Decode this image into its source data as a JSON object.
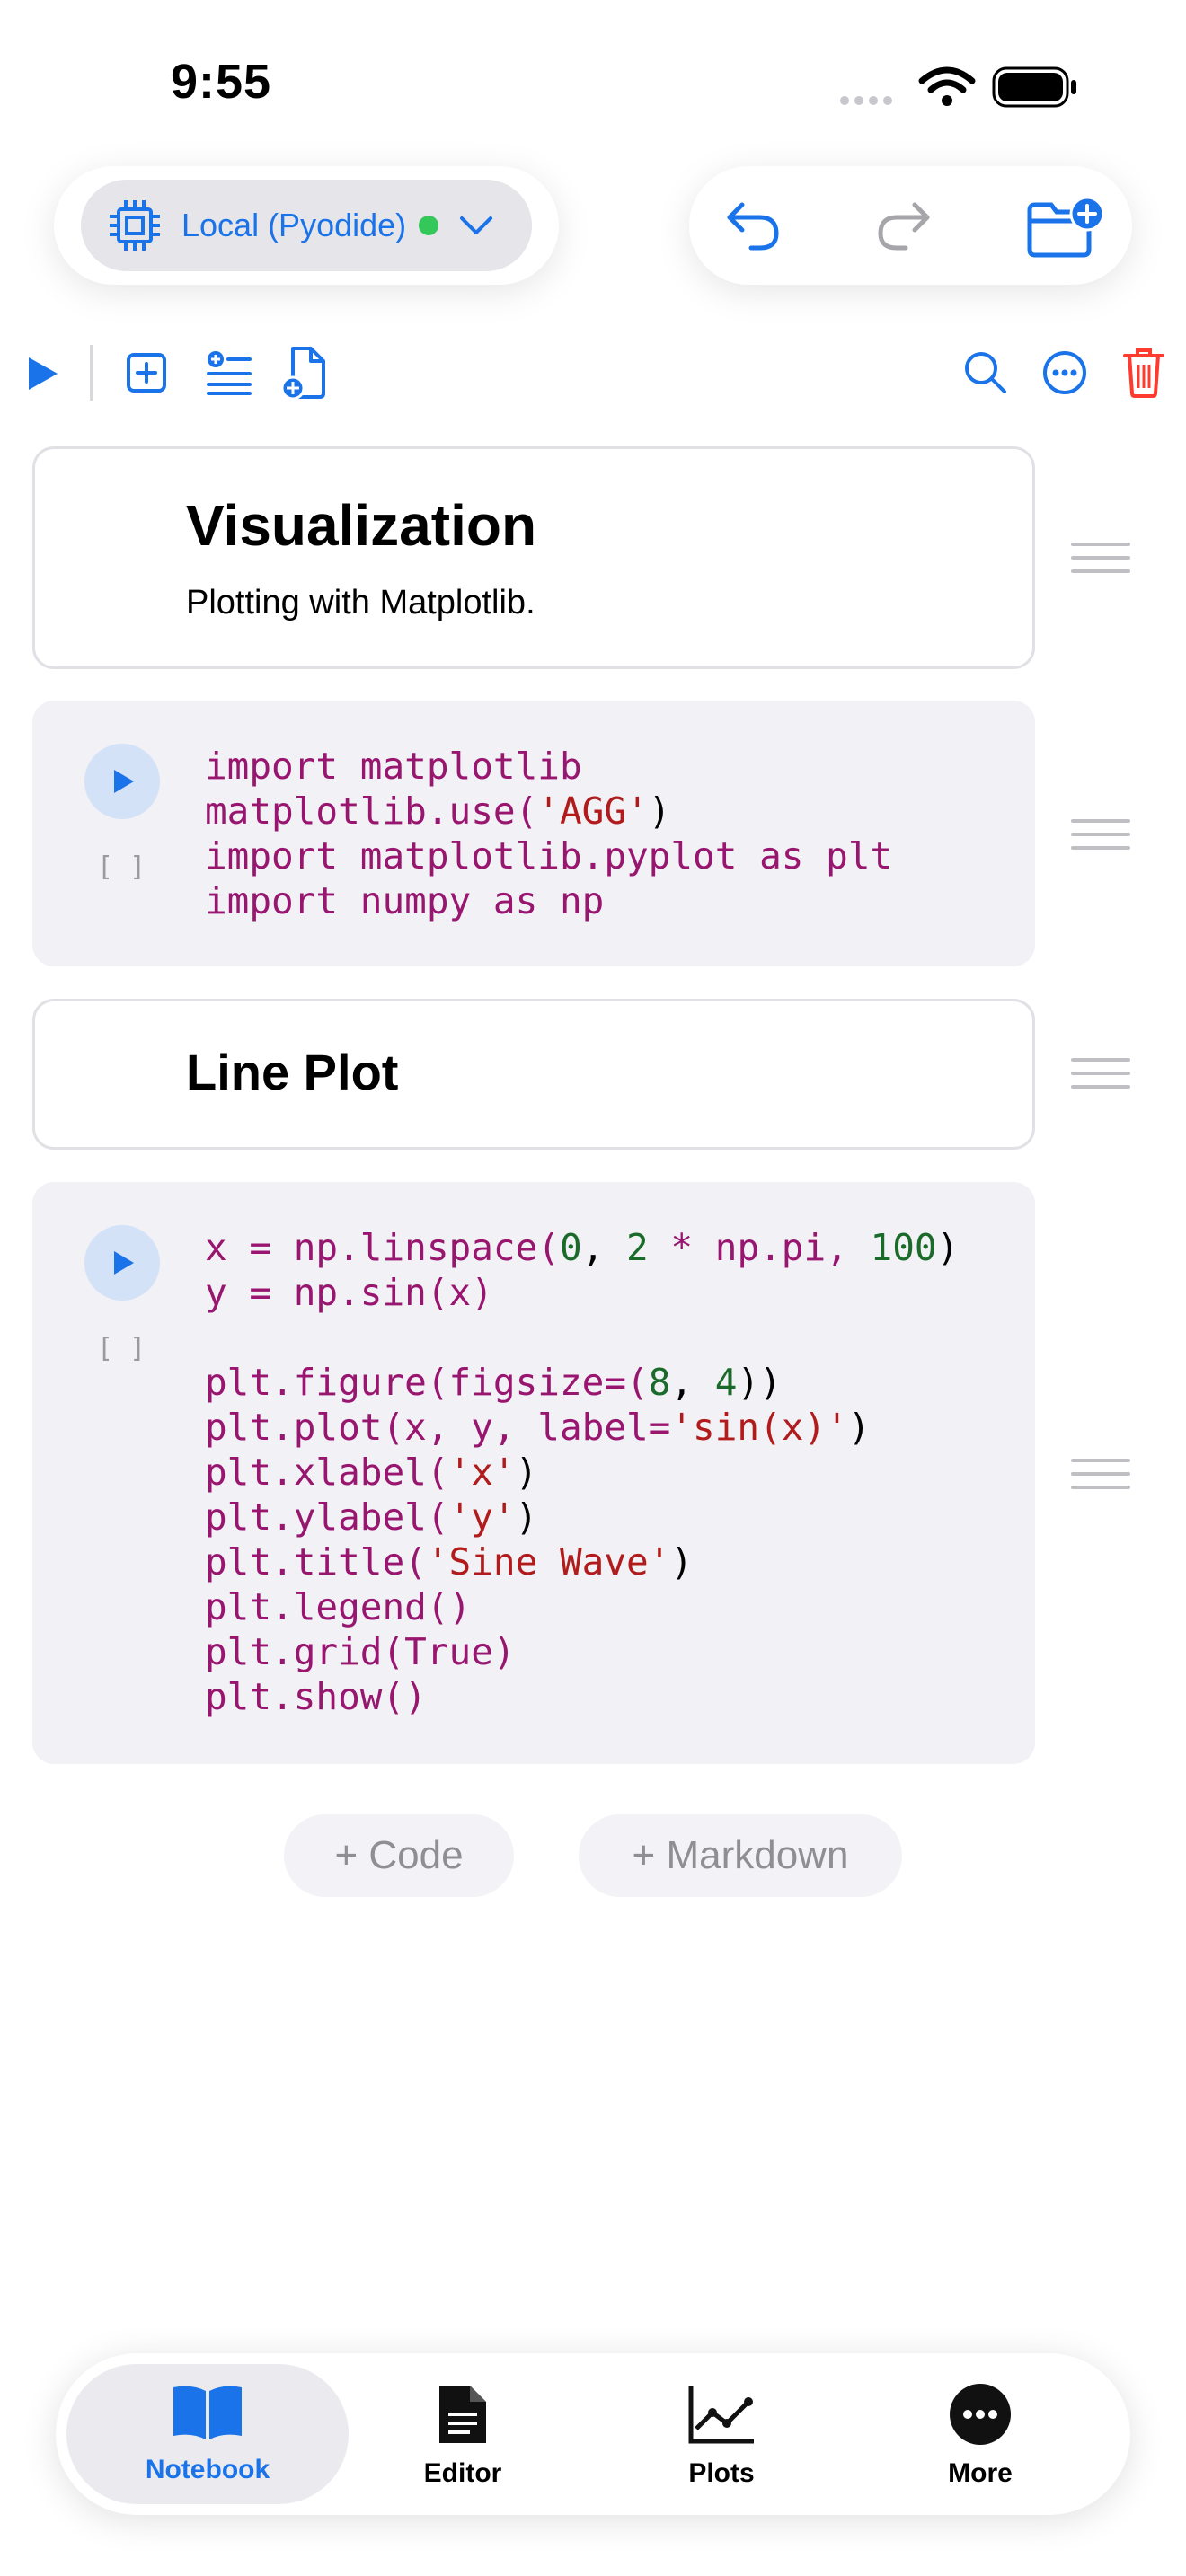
{
  "status_bar": {
    "time": "9:55"
  },
  "kernel": {
    "label": "Local (Pyodide)",
    "status_color": "#34c759"
  },
  "cells": [
    {
      "type": "markdown",
      "heading": "Visualization",
      "text": "Plotting with Matplotlib."
    },
    {
      "type": "code",
      "exec_count": "[ ]",
      "lines": [
        "import matplotlib",
        "matplotlib.use('AGG')",
        "import matplotlib.pyplot as plt",
        "import numpy as np"
      ]
    },
    {
      "type": "markdown",
      "heading": "Line Plot"
    },
    {
      "type": "code",
      "exec_count": "[ ]",
      "lines": [
        "x = np.linspace(0, 2 * np.pi, 100)",
        "y = np.sin(x)",
        "",
        "plt.figure(figsize=(8, 4))",
        "plt.plot(x, y, label='sin(x)')",
        "plt.xlabel('x')",
        "plt.ylabel('y')",
        "plt.title('Sine Wave')",
        "plt.legend()",
        "plt.grid(True)",
        "plt.show()"
      ]
    }
  ],
  "add_buttons": {
    "code": "+ Code",
    "markdown": "+ Markdown"
  },
  "tabs": [
    {
      "label": "Notebook",
      "icon": "book-icon",
      "active": true
    },
    {
      "label": "Editor",
      "icon": "document-icon",
      "active": false
    },
    {
      "label": "Plots",
      "icon": "chart-icon",
      "active": false
    },
    {
      "label": "More",
      "icon": "ellipsis-icon",
      "active": false
    }
  ],
  "colors": {
    "accent": "#1a73e8",
    "delete": "#ff3b30",
    "keyword": "#98166f",
    "string": "#b21b1b",
    "number": "#1a6b2a"
  }
}
